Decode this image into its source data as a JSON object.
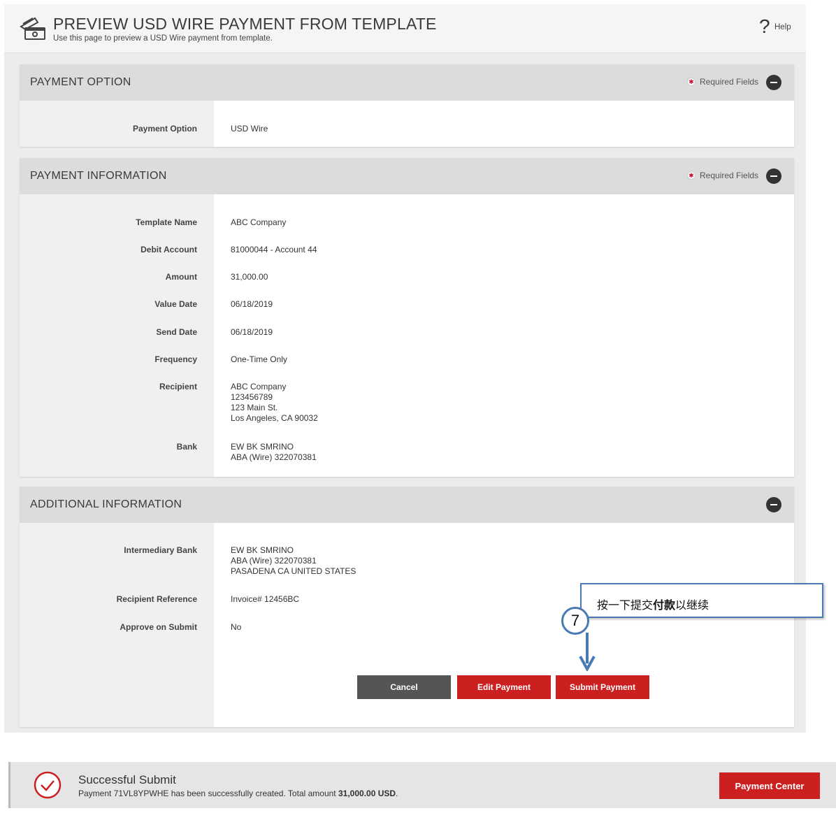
{
  "header": {
    "title": "PREVIEW USD WIRE PAYMENT FROM TEMPLATE",
    "subtitle": "Use this page to preview a USD Wire payment from template.",
    "help_label": "Help",
    "help_icon": "question-icon",
    "page_icon": "payment-template-icon"
  },
  "required_fields_label": "Required Fields",
  "payment_option_section": {
    "title": "PAYMENT OPTION",
    "fields": [
      {
        "label": "Payment Option",
        "value": "USD Wire"
      }
    ]
  },
  "payment_information_section": {
    "title": "PAYMENT INFORMATION",
    "fields": [
      {
        "label": "Template Name",
        "value": "ABC Company"
      },
      {
        "label": "Debit Account",
        "value": "81000044 - Account 44"
      },
      {
        "label": "Amount",
        "value": "31,000.00"
      },
      {
        "label": "Value Date",
        "value": "06/18/2019"
      },
      {
        "label": "Send Date",
        "value": "06/18/2019"
      },
      {
        "label": "Frequency",
        "value": "One-Time Only"
      },
      {
        "label": "Recipient",
        "value": "ABC Company\n123456789\n123 Main St.\nLos Angeles, CA 90032"
      },
      {
        "label": "Bank",
        "value": "EW BK SMRINO\nABA (Wire) 322070381"
      }
    ]
  },
  "additional_information_section": {
    "title": "ADDITIONAL INFORMATION",
    "fields": [
      {
        "label": "Intermediary Bank",
        "value": "EW BK SMRINO\nABA (Wire) 322070381\nPASADENA CA UNITED STATES"
      },
      {
        "label": "Recipient Reference",
        "value": "Invoice# 12456BC"
      },
      {
        "label": "Approve on Submit",
        "value": "No"
      }
    ]
  },
  "buttons": {
    "cancel": "Cancel",
    "edit": "Edit Payment",
    "submit": "Submit Payment"
  },
  "callout": {
    "step": "7",
    "text_before": "按一下提交",
    "text_bold": "付款",
    "text_after": "以继续"
  },
  "success": {
    "title": "Successful Submit",
    "message_before": "Payment 71VL8YPWHE has been successfully created. Total amount ",
    "message_amount": "31,000.00 USD",
    "message_after": ".",
    "button": "Payment Center"
  },
  "colors": {
    "accent_red": "#cc1f1f",
    "callout_blue": "#4a7ab5",
    "cancel_gray": "#555555"
  }
}
